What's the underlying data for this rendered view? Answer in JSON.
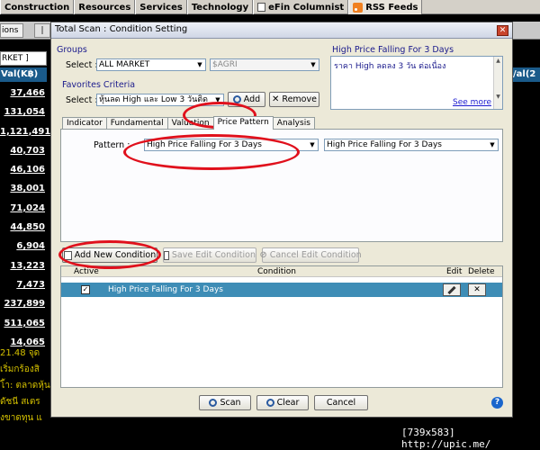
{
  "menubar": {
    "tabs": [
      "Construction",
      "Resources",
      "Services",
      "Technology",
      "eFin Columnist",
      "RSS Feeds"
    ]
  },
  "background": {
    "options_tab": "ions",
    "nav_arrows": "|<<",
    "left_header": "RKET ]",
    "left_header_tab": "Sele",
    "val_header": "Val(K฿)",
    "right_header": "/al(2",
    "values": [
      "37,466",
      "131,054",
      "1,121,491",
      "40,703",
      "46,106",
      "38,001",
      "71,024",
      "44,850",
      "6,904",
      "13,223",
      "7,473",
      "237,899",
      "511,065",
      "14,065"
    ],
    "bottom_lines": [
      "21.48 จุด",
      "เริ่มกร้องสิ",
      "โ้า: ตลาดหุ้น",
      "ดัชนี สเตร",
      "งขาดทุน แ"
    ],
    "status_tag": "[739x583] http://upic.me/"
  },
  "dialog": {
    "title": "Total Scan : Condition Setting",
    "groups": {
      "label": "Groups",
      "select_label": "Select :",
      "market_value": "ALL MARKET",
      "symbol_value": "$AGRI"
    },
    "favorites": {
      "label": "Favorites Criteria",
      "select_label": "Select :",
      "value": "หุ้นลด High และ Low 3 วันติด",
      "add_label": "Add",
      "remove_label": "Remove"
    },
    "description": {
      "title": "High Price Falling For 3 Days",
      "text": "ราคา High ลดลง 3 วัน ต่อเนื่อง",
      "see_more": "See more"
    },
    "tabs": [
      "Indicator",
      "Fundamental",
      "Valuation",
      "Price Pattern",
      "Analysis"
    ],
    "active_tab": "Price Pattern",
    "pattern": {
      "label": "Pattern :",
      "value_1": "High Price Falling For 3 Days",
      "value_2": "High Price Falling For 3 Days"
    },
    "condition_buttons": {
      "add": "Add New Condition",
      "save": "Save Edit Condition",
      "cancel": "Cancel Edit Condition"
    },
    "grid": {
      "col_active": "Active",
      "col_condition": "Condition",
      "col_edit": "Edit",
      "col_delete": "Delete",
      "rows": [
        {
          "active": true,
          "condition": "High Price Falling For 3 Days"
        }
      ]
    },
    "footer": {
      "scan": "Scan",
      "clear": "Clear",
      "cancel": "Cancel"
    }
  }
}
